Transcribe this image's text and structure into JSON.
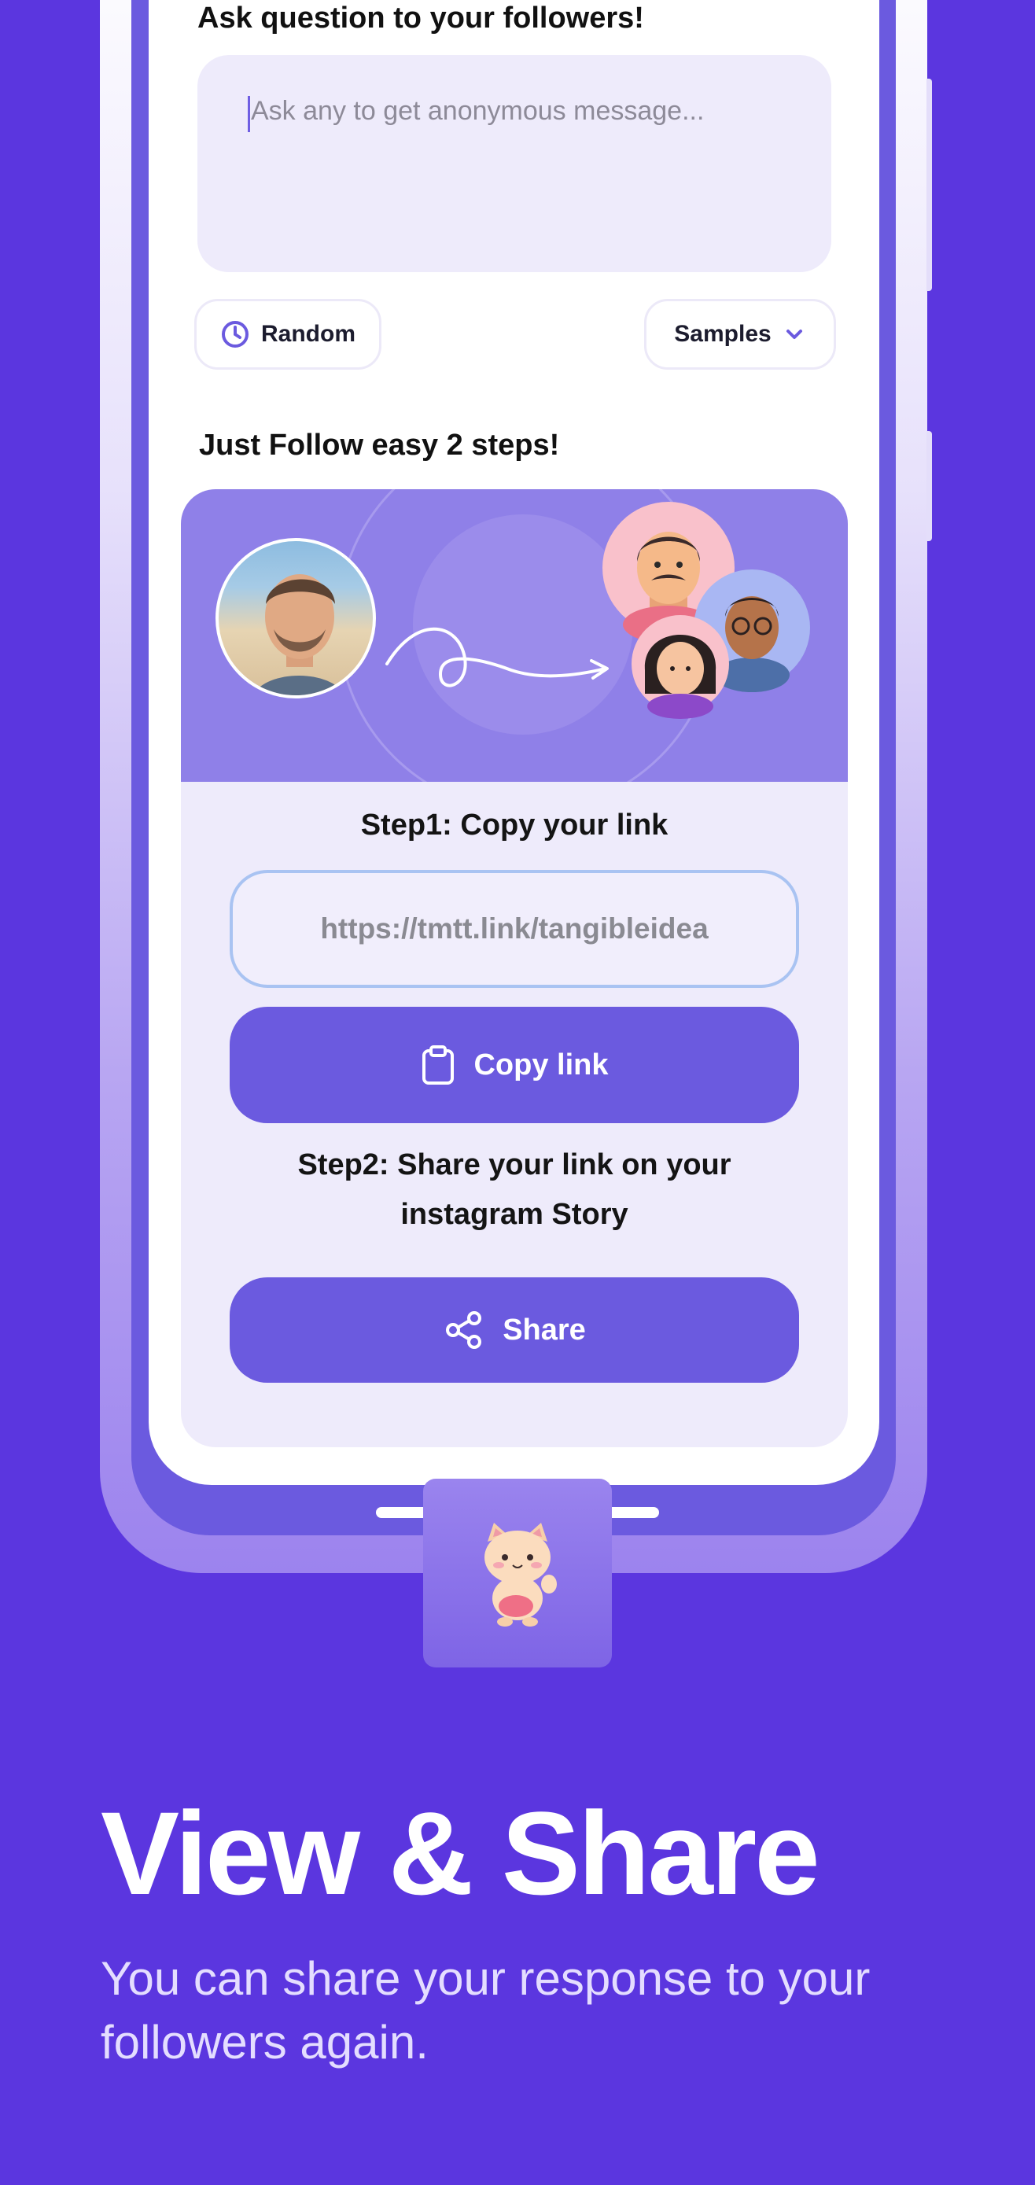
{
  "question_section": {
    "heading": "Ask question to your followers!",
    "input_placeholder": "Ask any to get anonymous message..."
  },
  "controls": {
    "random_label": "Random",
    "samples_label": "Samples"
  },
  "steps_heading": "Just Follow easy 2 steps!",
  "step1": {
    "title": "Step1: Copy your link",
    "link_value": "https://tmtt.link/tangibleidea",
    "copy_button": "Copy link"
  },
  "step2": {
    "title_line1": "Step2: Share your link on your",
    "title_line2": "instagram Story",
    "share_button": "Share"
  },
  "promo": {
    "headline": "View & Share",
    "subtext": "You can share your response to your followers again."
  },
  "icons": {
    "random": "clock-icon",
    "samples": "chevron-down-icon",
    "copy": "clipboard-icon",
    "share": "share-icon",
    "mascot": "cat-mascot-icon"
  },
  "colors": {
    "background": "#5b36df",
    "accent": "#6b5adf",
    "card": "#eeebfb",
    "hero": "#8f80e8"
  }
}
